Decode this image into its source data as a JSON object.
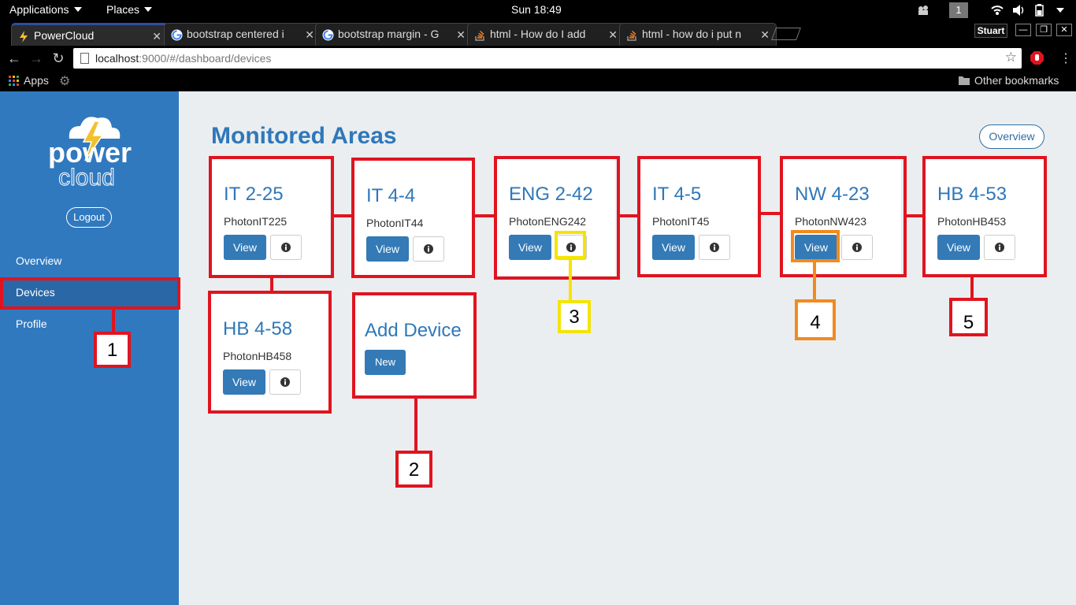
{
  "topbar": {
    "applications": "Applications",
    "places": "Places",
    "clock": "Sun 18:49",
    "workspace": "1"
  },
  "tabs": [
    {
      "title": "PowerCloud",
      "active": true
    },
    {
      "title": "bootstrap centered i",
      "active": false
    },
    {
      "title": "bootstrap margin - G",
      "active": false
    },
    {
      "title": "html - How do I add",
      "active": false
    },
    {
      "title": "html - how do i put n",
      "active": false
    }
  ],
  "window": {
    "user": "Stuart"
  },
  "address": {
    "host": "localhost",
    "path": ":9000/#/dashboard/devices"
  },
  "bookmarks": {
    "apps": "Apps",
    "other": "Other bookmarks"
  },
  "sidebar": {
    "brand_top": "power",
    "brand_bottom": "cloud",
    "logout": "Logout",
    "items": [
      {
        "label": "Overview"
      },
      {
        "label": "Devices"
      },
      {
        "label": "Profile"
      }
    ]
  },
  "main": {
    "title": "Monitored Areas",
    "overview_button": "Overview",
    "view_label": "View",
    "cards": [
      {
        "title": "IT 2-25",
        "id": "PhotonIT225"
      },
      {
        "title": "IT 4-4",
        "id": "PhotonIT44"
      },
      {
        "title": "ENG 2-42",
        "id": "PhotonENG242"
      },
      {
        "title": "IT 4-5",
        "id": "PhotonIT45"
      },
      {
        "title": "NW 4-23",
        "id": "PhotonNW423"
      },
      {
        "title": "HB 4-53",
        "id": "PhotonHB453"
      },
      {
        "title": "HB 4-58",
        "id": "PhotonHB458"
      }
    ],
    "add_device": {
      "title": "Add Device",
      "button": "New"
    }
  },
  "annotations": {
    "labels": [
      "1",
      "2",
      "3",
      "4",
      "5"
    ],
    "colors": {
      "red": "#e0141f",
      "yellow": "#f5e400",
      "orange": "#f28a1e"
    }
  },
  "colors": {
    "sidebar": "#3079bf",
    "accent": "#337ab7",
    "title": "#2f78b9"
  }
}
